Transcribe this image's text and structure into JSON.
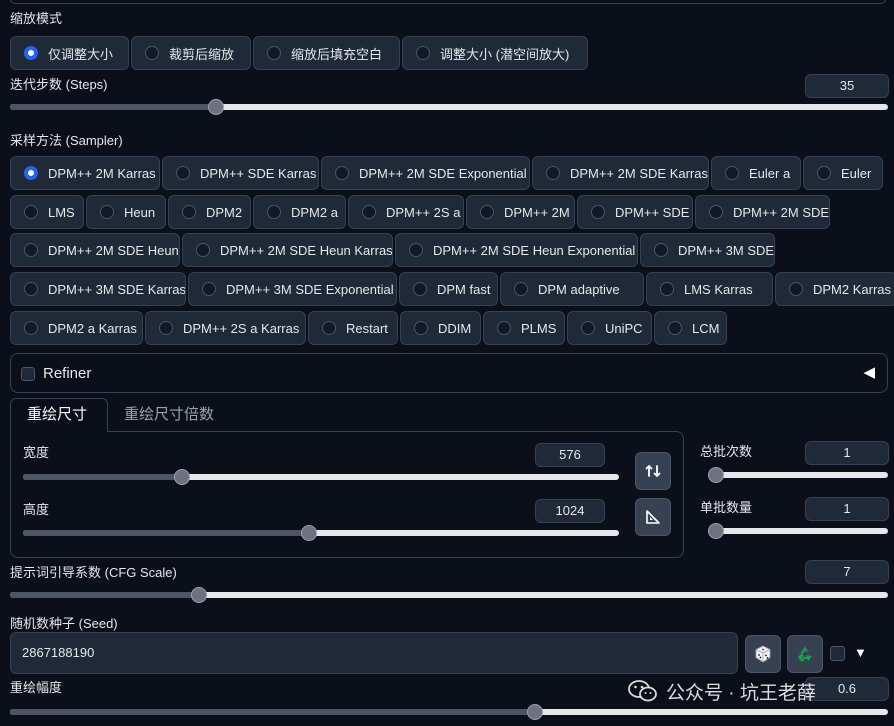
{
  "resize_mode": {
    "title": "缩放模式",
    "options": [
      "仅调整大小",
      "裁剪后缩放",
      "缩放后填充空白",
      "调整大小 (潜空间放大)"
    ],
    "selected": "仅调整大小"
  },
  "steps": {
    "label": "迭代步数 (Steps)",
    "value": "35",
    "min": 1,
    "max": 150,
    "level": 0.23
  },
  "sampler": {
    "title": "采样方法 (Sampler)",
    "selected": "DPM++ 2M Karras",
    "options": [
      "DPM++ 2M Karras",
      "DPM++ SDE Karras",
      "DPM++ 2M SDE Exponential",
      "DPM++ 2M SDE Karras",
      "Euler a",
      "Euler",
      "LMS",
      "Heun",
      "DPM2",
      "DPM2 a",
      "DPM++ 2S a",
      "DPM++ 2M",
      "DPM++ SDE",
      "DPM++ 2M SDE",
      "DPM++ 2M SDE Heun",
      "DPM++ 2M SDE Heun Karras",
      "DPM++ 2M SDE Heun Exponential",
      "DPM++ 3M SDE",
      "DPM++ 3M SDE Karras",
      "DPM++ 3M SDE Exponential",
      "DPM fast",
      "DPM adaptive",
      "LMS Karras",
      "DPM2 Karras",
      "DPM2 a Karras",
      "DPM++ 2S a Karras",
      "Restart",
      "DDIM",
      "PLMS",
      "UniPC",
      "LCM"
    ]
  },
  "refiner": {
    "label": "Refiner",
    "checked": false,
    "arrow": "◀"
  },
  "size_tabs": {
    "active": "重绘尺寸",
    "inactive": "重绘尺寸倍数"
  },
  "width": {
    "label": "宽度",
    "value": "576",
    "min": 64,
    "max": 2048,
    "level": 0.26
  },
  "height": {
    "label": "高度",
    "value": "1024",
    "min": 64,
    "max": 2048,
    "level": 0.48
  },
  "swap_icon": "swap-vertical-icon",
  "ratio_icon": "set-square-icon",
  "batch_count": {
    "label": "总批次数",
    "value": "1",
    "min": 1,
    "max": 100,
    "level": 0.0
  },
  "batch_size": {
    "label": "单批数量",
    "value": "1",
    "min": 1,
    "max": 8,
    "level": 0.0
  },
  "cfg": {
    "label": "提示词引导系数 (CFG Scale)",
    "value": "7",
    "min": 1,
    "max": 30,
    "level": 0.21
  },
  "seed": {
    "label": "随机数种子 (Seed)",
    "value": "2867188190",
    "dice_icon": "dice-icon",
    "recycle_icon": "recycle-icon",
    "dropdown_arrow": "▼"
  },
  "denoise": {
    "label": "重绘幅度",
    "value": "0.6",
    "min": 0,
    "max": 1,
    "level": 0.6
  },
  "watermark": "公众号 · 坑王老薛",
  "colors": {
    "background": "#0b0f19",
    "accent": "#2563eb",
    "panel": "#1f2937",
    "border": "#374151"
  }
}
